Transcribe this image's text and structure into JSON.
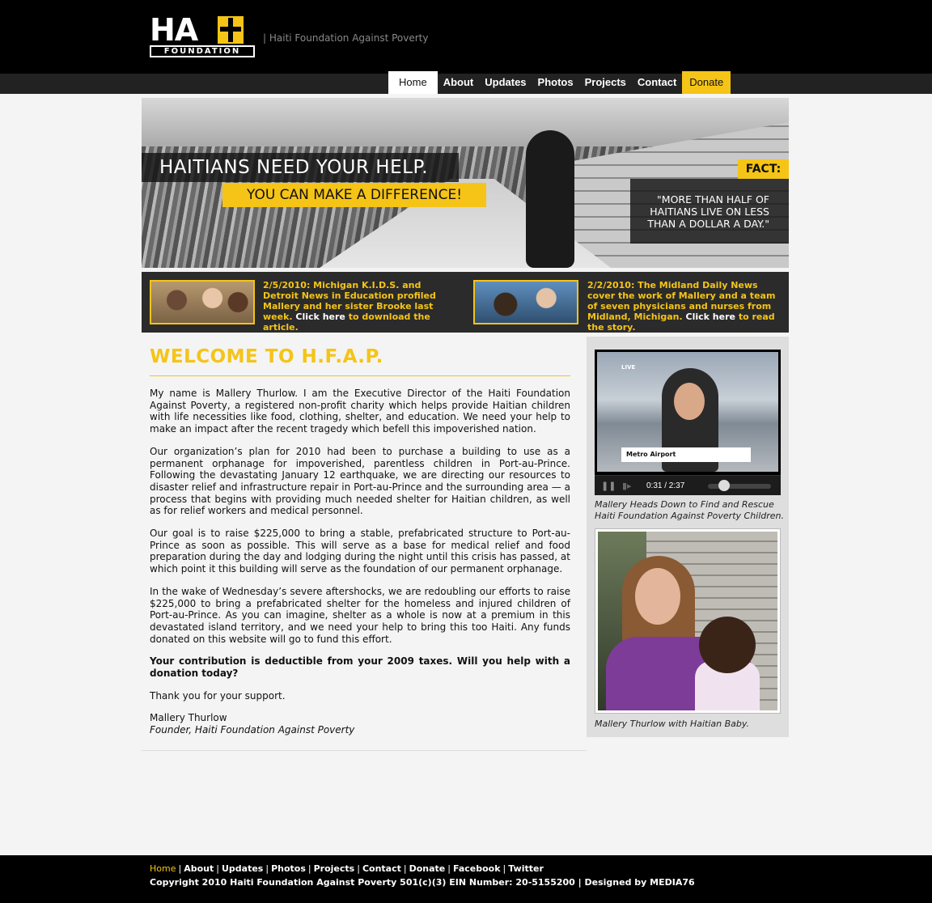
{
  "header": {
    "logo_text": "HAITI",
    "logo_subtext": "FOUNDATION",
    "tagline": "| Haiti Foundation Against Poverty"
  },
  "nav": {
    "items": [
      {
        "label": "Home"
      },
      {
        "label": "About"
      },
      {
        "label": "Updates"
      },
      {
        "label": "Photos"
      },
      {
        "label": "Projects"
      },
      {
        "label": "Contact"
      },
      {
        "label": "Donate"
      }
    ]
  },
  "banner": {
    "headline": "HAITIANS NEED YOUR HELP.",
    "subheadline": "YOU CAN MAKE A DIFFERENCE!",
    "fact_label": "FACT:",
    "fact_text": "\"MORE THAN HALF OF HAITIANS LIVE ON LESS THAN A DOLLAR A DAY.\""
  },
  "news": [
    {
      "text": "2/5/2010: Michigan K.I.D.S. and Detroit News in Education profiled Mallery and her sister Brooke last week.",
      "link": "Click here",
      "after": "to download the article."
    },
    {
      "text": "2/2/2010: The Midland Daily News cover the work of Mallery and a team of seven physicians and nurses from Midland, Michigan.",
      "link": "Click here",
      "after": "to read the story."
    }
  ],
  "main": {
    "title": "WELCOME TO H.F.A.P.",
    "paragraphs": [
      "My name is Mallery Thurlow. I am the Executive Director of the Haiti Foundation Against Poverty, a registered non-profit charity which helps provide Haitian children with life necessities like food, clothing, shelter, and education. We need your help to make an impact after the recent tragedy which befell this impoverished nation.",
      "Our organization’s plan for 2010 had been to purchase a building to use as a permanent orphanage for impoverished, parentless children in Port-au-Prince. Following the devastating January 12 earthquake, we are directing our resources to disaster relief and infrastructure repair in Port-au-Prince and the surrounding area — a process that begins with providing much needed shelter for Haitian children, as well as for relief workers and medical personnel.",
      "Our goal is to raise $225,000 to bring a stable, prefabricated structure to Port-au-Prince as soon as possible. This will serve as a base for medical relief and food preparation during the day and lodging during the night until this crisis has passed, at which point it this building will serve as the foundation of our permanent orphanage.",
      "In the wake of Wednesday’s severe aftershocks, we are redoubling our efforts to raise $225,000 to bring a prefabricated shelter for the homeless and injured children of Port-au-Prince. As you can imagine, shelter as a whole is now at a premium in this devastated island territory, and we need your help to bring this too Haiti. Any funds donated on this website will go to fund this effort."
    ],
    "bold_paragraph": "Your contribution is deductible from your 2009 taxes. Will you help with a donation today?",
    "thanks": "Thank you for your support.",
    "signature_name": "Mallery Thurlow",
    "signature_role": "Founder, Haiti Foundation Against Poverty"
  },
  "sidebar": {
    "video": {
      "live_label": "LIVE",
      "lower_third": "Metro Airport",
      "time": "0:31 / 2:37",
      "progress_fraction": 0.2
    },
    "video_caption": "Mallery Heads Down to Find and Rescue Haiti Foundation Against Poverty Children.",
    "photo_caption": "Mallery Thurlow with Haitian Baby."
  },
  "footer": {
    "links": [
      {
        "label": "Home"
      },
      {
        "label": "About"
      },
      {
        "label": "Updates"
      },
      {
        "label": "Photos"
      },
      {
        "label": "Projects"
      },
      {
        "label": "Contact"
      },
      {
        "label": "Donate"
      },
      {
        "label": "Facebook"
      },
      {
        "label": "Twitter"
      }
    ],
    "copyright": "Copyright 2010 Haiti Foundation Against Poverty 501(c)(3) EIN Number: 20-5155200 | Designed by MEDIA76"
  },
  "colors": {
    "accent": "#f5c417",
    "header_bg": "#000000",
    "page_bg": "#f4f4f4",
    "sidebar_bg": "#dedede"
  }
}
